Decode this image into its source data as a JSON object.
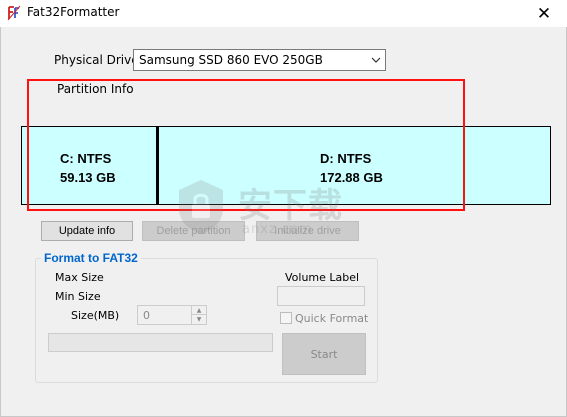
{
  "window": {
    "title": "Fat32Formatter",
    "close_glyph": "✕"
  },
  "drive": {
    "label": "Physical Drive",
    "selected": "Samsung SSD 860 EVO 250GB"
  },
  "partition_info": {
    "label": "Partition Info",
    "partitions": [
      {
        "name": "C: NTFS",
        "size": "59.13 GB"
      },
      {
        "name": "D: NTFS",
        "size": "172.88 GB"
      }
    ]
  },
  "buttons": {
    "update": "Update info",
    "delete": "Delete partition",
    "initialize": "Initialize drive"
  },
  "format": {
    "group_title": "Format to FAT32",
    "max_size_label": "Max Size",
    "min_size_label": "Min Size",
    "size_label": "Size(MB)",
    "size_value": "0",
    "volume_label_label": "Volume Label",
    "volume_label_value": "",
    "quick_format_label": "Quick Format",
    "quick_format_checked": false,
    "start_label": "Start",
    "progress": 0
  },
  "watermark": {
    "text": "安下载",
    "sub": "anxz.com"
  },
  "colors": {
    "partition_fill": "#ccffff",
    "highlight": "#ff1111",
    "group_title": "#0066cc"
  },
  "icons": {
    "app": "fat32-app-icon",
    "close": "close-icon",
    "dropdown": "chevron-down-icon",
    "spin_up": "spin-up-icon",
    "spin_down": "spin-down-icon"
  }
}
